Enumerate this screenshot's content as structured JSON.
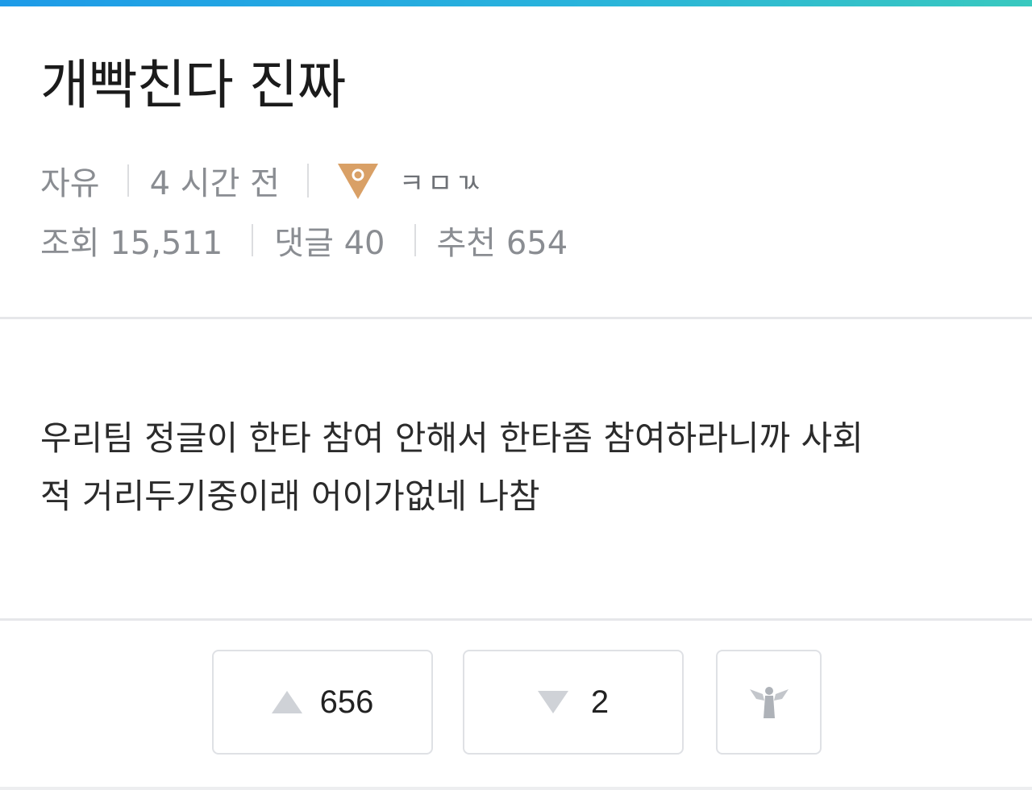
{
  "post": {
    "title": "개빡친다 진짜",
    "category": "자유",
    "time": "4 시간 전",
    "author": "ㅋㅁㄳ",
    "tier_icon": "bronze-tier-triangle-icon",
    "stats": {
      "views": "조회 15,511",
      "comments": "댓글 40",
      "recommends": "추천 654"
    },
    "body_lines": [
      "우리팀 정글이 한타 참여 안해서 한타좀 참여하라니까 사회",
      "적 거리두기중이래 어이가없네 나참"
    ]
  },
  "votes": {
    "up_count": "656",
    "down_count": "2",
    "up_icon": "upvote-triangle-icon",
    "down_icon": "downvote-triangle-icon",
    "angel_icon": "angel-icon"
  },
  "colors": {
    "accent_gradient_start": "#1e9be8",
    "accent_gradient_end": "#39c9bf",
    "tier_icon": "#d9a066",
    "meta_text": "#8a8d92"
  }
}
